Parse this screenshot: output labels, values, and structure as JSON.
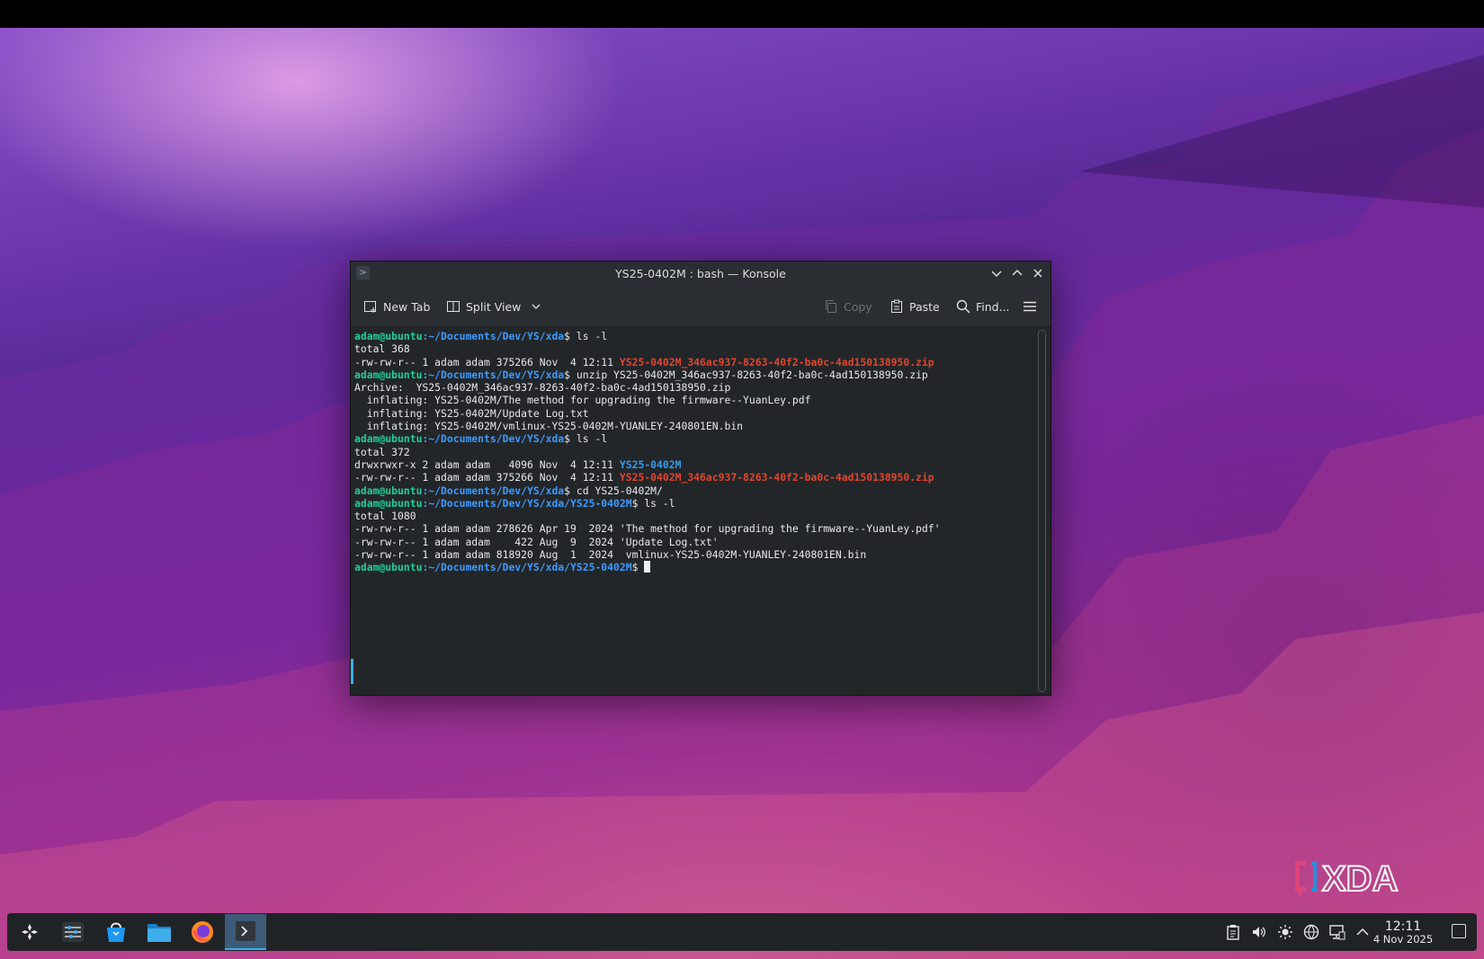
{
  "window": {
    "title": "YS25-0402M : bash — Konsole"
  },
  "toolbar": {
    "new_tab": "New Tab",
    "split_view": "Split View",
    "copy": "Copy",
    "paste": "Paste",
    "find": "Find..."
  },
  "terminal": {
    "user_host": "adam@ubuntu",
    "path_xda": ":~/Documents/Dev/YS/xda",
    "path_ys": ":~/Documents/Dev/YS/xda/YS25-0402M",
    "lines": {
      "cmd1": "$ ls -l",
      "out1": "total 368",
      "out2_prefix": "-rw-rw-r-- 1 adam adam 375266 Nov  4 12:11 ",
      "zip_name": "YS25-0402M_346ac937-8263-40f2-ba0c-4ad150138950.zip",
      "cmd2": "$ unzip YS25-0402M_346ac937-8263-40f2-ba0c-4ad150138950.zip",
      "archive": "Archive:  YS25-0402M_346ac937-8263-40f2-ba0c-4ad150138950.zip",
      "inflate1": "  inflating: YS25-0402M/The method for upgrading the firmware--YuanLey.pdf",
      "inflate2": "  inflating: YS25-0402M/Update Log.txt",
      "inflate3": "  inflating: YS25-0402M/vmlinux-YS25-0402M-YUANLEY-240801EN.bin",
      "cmd3": "$ ls -l",
      "out3": "total 372",
      "out4_prefix": "drwxrwxr-x 2 adam adam   4096 Nov  4 12:11 ",
      "dir_name": "YS25-0402M",
      "out5_prefix": "-rw-rw-r-- 1 adam adam 375266 Nov  4 12:11 ",
      "cmd4": "$ cd YS25-0402M/",
      "cmd5": "$ ls -l",
      "out6": "total 1080",
      "out7": "-rw-rw-r-- 1 adam adam 278626 Apr 19  2024 'The method for upgrading the firmware--YuanLey.pdf'",
      "out8": "-rw-rw-r-- 1 adam adam    422 Aug  9  2024 'Update Log.txt'",
      "out9": "-rw-rw-r-- 1 adam adam 818920 Aug  1  2024  vmlinux-YS25-0402M-YUANLEY-240801EN.bin",
      "prompt_end": "$ "
    }
  },
  "taskbar": {
    "clock_time": "12:11",
    "clock_date": "4 Nov 2025"
  },
  "colors": {
    "accent": "#3daee9",
    "prompt_user": "#1ccf9a",
    "prompt_path": "#3b9bff",
    "archive_red": "#e0452e",
    "directory_blue": "#2f9cf0"
  },
  "icons": [
    "app-launcher-icon",
    "settings-icon",
    "discover-icon",
    "file-manager-icon",
    "firefox-icon",
    "konsole-icon",
    "clipboard-icon",
    "volume-icon",
    "brightness-icon",
    "network-icon",
    "display-icon",
    "tray-expand-icon",
    "show-desktop-icon"
  ]
}
